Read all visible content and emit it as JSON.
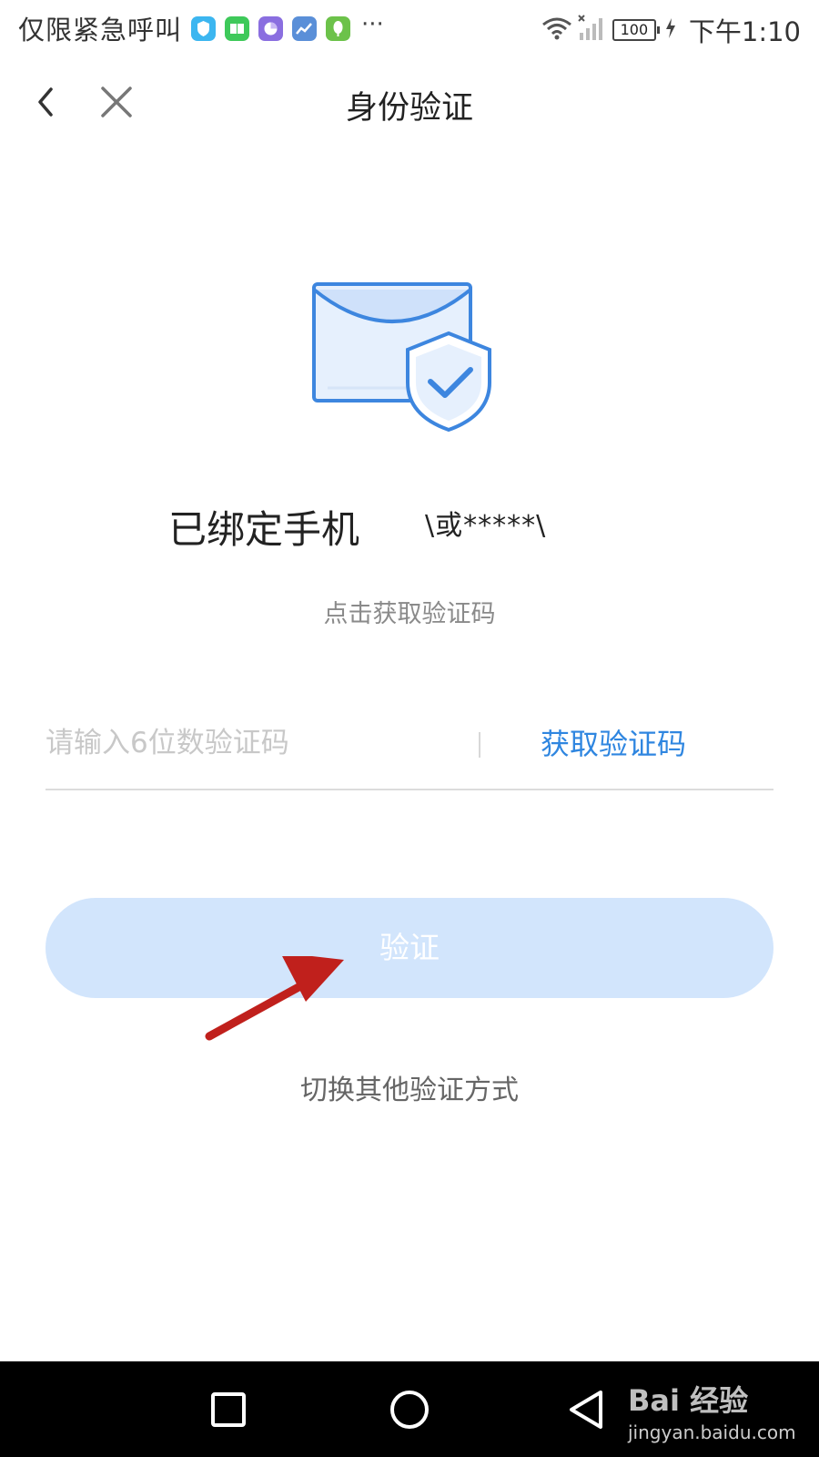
{
  "status_bar": {
    "carrier": "仅限紧急呼叫",
    "more": "···",
    "battery": "100",
    "time": "下午1:10",
    "app_icons": [
      "shield-app-icon",
      "book-app-icon",
      "chart-app-icon",
      "stock-app-icon",
      "leaf-app-icon"
    ]
  },
  "nav": {
    "title": "身份验证",
    "back_icon": "back-arrow-icon",
    "close_icon": "close-icon"
  },
  "illustration": {
    "icon": "envelope-shield-icon",
    "colors": {
      "outline": "#3d86df",
      "fill": "#e6f0fd"
    }
  },
  "verification": {
    "phone_label": "已绑定手机",
    "phone_masked": "\\或*****\\",
    "hint": "点击获取验证码",
    "code_placeholder": "请输入6位数验证码",
    "get_code_label": "获取验证码",
    "verify_label": "验证",
    "switch_label": "切换其他验证方式"
  },
  "colors": {
    "accent": "#2f86e0",
    "button_bg": "#d2e5fc",
    "annotation_arrow": "#c0201c"
  },
  "system_nav": {
    "icons": [
      "recent-apps-icon",
      "home-icon",
      "back-triangle-icon"
    ],
    "watermark_top": "Bai 经验",
    "watermark_bottom": "jingyan.baidu.com"
  }
}
